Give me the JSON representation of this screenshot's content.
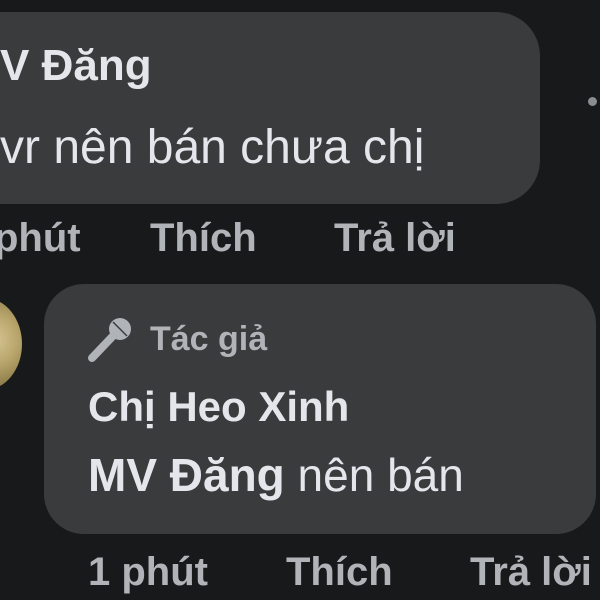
{
  "colors": {
    "background": "#18191a",
    "bubble": "#3a3b3c",
    "primary_text": "#e4e6eb",
    "secondary_text": "#b0b3b8"
  },
  "comment_1": {
    "author": "V Đăng",
    "text": "vr nên bán chưa chị",
    "actions": {
      "time": "phút",
      "like": "Thích",
      "reply": "Trả lời"
    }
  },
  "comment_2": {
    "badge_icon": "microphone-icon",
    "badge_label": "Tác giả",
    "author": "Chị Heo Xinh",
    "mention": "MV Đăng",
    "text": " nên bán",
    "actions": {
      "time": "1 phút",
      "like": "Thích",
      "reply": "Trả lời"
    }
  }
}
